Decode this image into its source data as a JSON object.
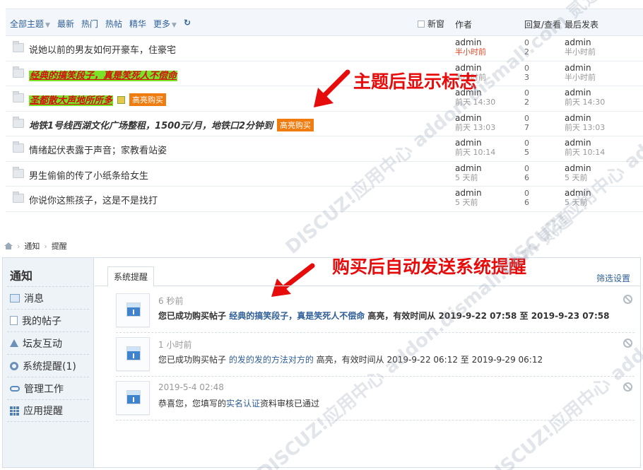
{
  "forum": {
    "filters": [
      "全部主题",
      "最新",
      "热门",
      "热帖",
      "精华",
      "更多"
    ],
    "new_window_label": "新窗",
    "columns": {
      "author": "作者",
      "replies_views": "回复/查看",
      "last_post": "最后发表"
    },
    "threads": [
      {
        "title": "说她以前的男友如何开豪车，住豪宅",
        "style": "normal",
        "badge": "",
        "author": "admin",
        "author_time": "半小时前",
        "replies": "0",
        "views": "2",
        "last_user": "admin",
        "last_time": "半小时前"
      },
      {
        "title": "经典的搞笑段子，真是笑死人不偿命",
        "style": "highlight",
        "badge": "",
        "author": "admin",
        "author_time": "半小时前",
        "replies": "0",
        "views": "3",
        "last_user": "admin",
        "last_time": "半小时前"
      },
      {
        "title": "圣都散大声地所所多",
        "style": "highlight",
        "badge": "高亮购买",
        "author": "admin",
        "author_time": "前天 14:30",
        "replies": "0",
        "views": "2",
        "last_user": "admin",
        "last_time": "前天 14:30"
      },
      {
        "title": "地铁1号线西湖文化广场整租，1500元/月，地铁口2分钟到",
        "style": "bold",
        "badge": "高亮购买",
        "author": "admin",
        "author_time": "前天 13:03",
        "replies": "0",
        "views": "7",
        "last_user": "admin",
        "last_time": "前天 13:03"
      },
      {
        "title": "情绪起伏表露于声音；家教看站姿",
        "style": "normal",
        "badge": "",
        "author": "admin",
        "author_time": "前天 10:14",
        "replies": "0",
        "views": "5",
        "last_user": "admin",
        "last_time": "前天 10:14"
      },
      {
        "title": "男生偷偷的传了小纸条给女生",
        "style": "normal",
        "badge": "",
        "author": "admin",
        "author_time": "5 天前",
        "replies": "0",
        "views": "6",
        "last_user": "admin",
        "last_time": "5 天前"
      },
      {
        "title": "你说你这熊孩子，这是不是找打",
        "style": "normal",
        "badge": "",
        "author": "admin",
        "author_time": "5 天前",
        "replies": "0",
        "views": "6",
        "last_user": "admin",
        "last_time": "5 天前"
      }
    ]
  },
  "annotations": {
    "top": "主题后显示标志",
    "bottom": "购买后自动发送系统提醒"
  },
  "breadcrumb": [
    "通知",
    "提醒"
  ],
  "sidebar": {
    "title": "通知",
    "items": [
      {
        "label": "消息",
        "icon": "mail-icon"
      },
      {
        "label": "我的帖子",
        "icon": "document-icon"
      },
      {
        "label": "坛友互动",
        "icon": "triangle-icon"
      },
      {
        "label": "系统提醒(1)",
        "icon": "gear-icon"
      },
      {
        "label": "管理工作",
        "icon": "link-icon"
      },
      {
        "label": "应用提醒",
        "icon": "grid-icon"
      }
    ]
  },
  "tab": {
    "label": "系统提醒"
  },
  "filter_settings": "筛选设置",
  "notices": [
    {
      "time": "6 秒前",
      "prefix": "您已成功购买帖子 ",
      "link": "经典的搞笑段子，真是笑死人不偿命",
      "suffix": " 高亮，有效时间从 2019-9-22 07:58 至 2019-9-23 07:58",
      "strong": true
    },
    {
      "time": "1 小时前",
      "prefix": "您已成功购买帖子 ",
      "link": "的发的发的方法对方的",
      "suffix": " 高亮，有效时间从 2019-9-22 06:12 至 2019-9-29 06:12",
      "strong": false
    },
    {
      "time": "2019-5-4 02:48",
      "prefix": "恭喜您，您填写的",
      "link": "实名认证",
      "suffix": "资料审核已通过",
      "strong": false
    }
  ],
  "watermark": "DISCUZ!应用中心 addon.dismall.com 贰道",
  "colors": {
    "accent": "#2f5f98",
    "badge": "#f07b0e",
    "highlight_bg": "#7be227",
    "highlight_text": "#d40d0d",
    "annotation": "#e60c0c"
  }
}
